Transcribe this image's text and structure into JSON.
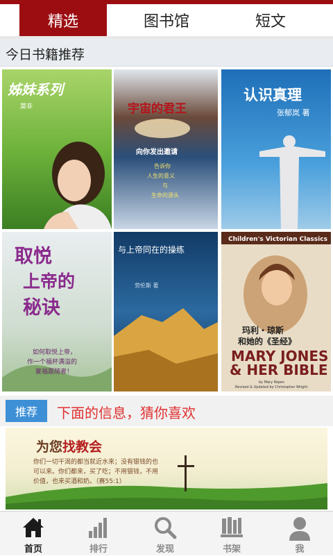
{
  "tabs": [
    {
      "label": "精选",
      "active": true
    },
    {
      "label": "图书馆",
      "active": false
    },
    {
      "label": "短文",
      "active": false
    }
  ],
  "section": {
    "title": "今日书籍推荐"
  },
  "books": [
    {
      "title": "姊妹系列",
      "author": "莫非"
    },
    {
      "title": "宇宙的君王",
      "subtitle": "向你发出邀请",
      "lines": [
        "告诉你",
        "人生的意义",
        "与",
        "生命的源头"
      ]
    },
    {
      "title": "认识真理",
      "author": "张郁岚 著"
    },
    {
      "title_lines": [
        "取悦",
        "上帝的",
        "秘诀"
      ],
      "subtitle_lines": [
        "如何取悦上帝，",
        "作一个福杯满溢的",
        "蒙福跟随者！"
      ]
    },
    {
      "title": "与上帝同在的操练",
      "author": "劳伦斯 著"
    },
    {
      "series": "Children's Victorian Classics",
      "cn_title_lines": [
        "玛利・琼斯",
        "和她的《圣经》"
      ],
      "en_title_lines": [
        "MARY JONES",
        "& HER BIBLE"
      ],
      "credits": [
        "by Mary Ropes",
        "Revised & Updated by Christopher Wright"
      ]
    }
  ],
  "recommend": {
    "badge": "推荐",
    "text": "下面的信息，猜你喜欢"
  },
  "banner": {
    "title_prefix": "为您",
    "title_highlight": "找教会",
    "lines": [
      "你们一切干渴的都当就近水来；没有银钱的也",
      "可以来。你们都来，买了吃；不用银钱，不用",
      "价值，也来买酒和奶。（赛55:1）"
    ]
  },
  "nav": [
    {
      "label": "首页",
      "icon": "home-icon",
      "active": true
    },
    {
      "label": "排行",
      "icon": "bar-chart-icon",
      "active": false
    },
    {
      "label": "发现",
      "icon": "search-icon",
      "active": false
    },
    {
      "label": "书架",
      "icon": "bookshelf-icon",
      "active": false
    },
    {
      "label": "我",
      "icon": "user-icon",
      "active": false
    }
  ],
  "colors": {
    "brand": "#9c0d12",
    "accent": "#3e90d6",
    "highlight": "#e03030"
  }
}
